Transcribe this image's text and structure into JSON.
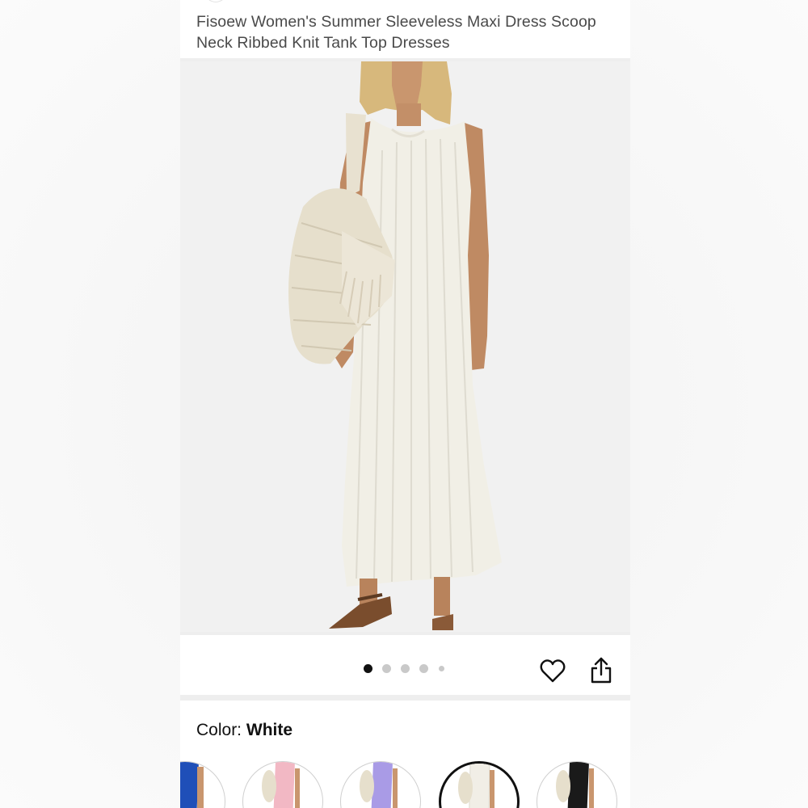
{
  "product": {
    "title": "Fisoew Women's Summer Sleeveless Maxi Dress Scoop Neck Ribbed Knit Tank Top Dresses"
  },
  "gallery": {
    "image_icon": "product-photo-white-dress",
    "dot_count": 5,
    "active_dot": 1
  },
  "actions": {
    "favorite_icon": "heart-icon",
    "share_icon": "share-icon"
  },
  "color": {
    "label": "Color:",
    "value": "White",
    "swatches": [
      {
        "name": "blue",
        "hex": "#1f4fb8"
      },
      {
        "name": "pink",
        "hex": "#f2b8c4"
      },
      {
        "name": "purple",
        "hex": "#a99be6"
      },
      {
        "name": "white",
        "hex": "#f1eee6",
        "selected": true
      },
      {
        "name": "black",
        "hex": "#1a1a1a"
      }
    ]
  },
  "colors": {
    "page_background": "#f3f3f3",
    "card_background": "#ffffff",
    "title_text": "#4a4a4a"
  }
}
